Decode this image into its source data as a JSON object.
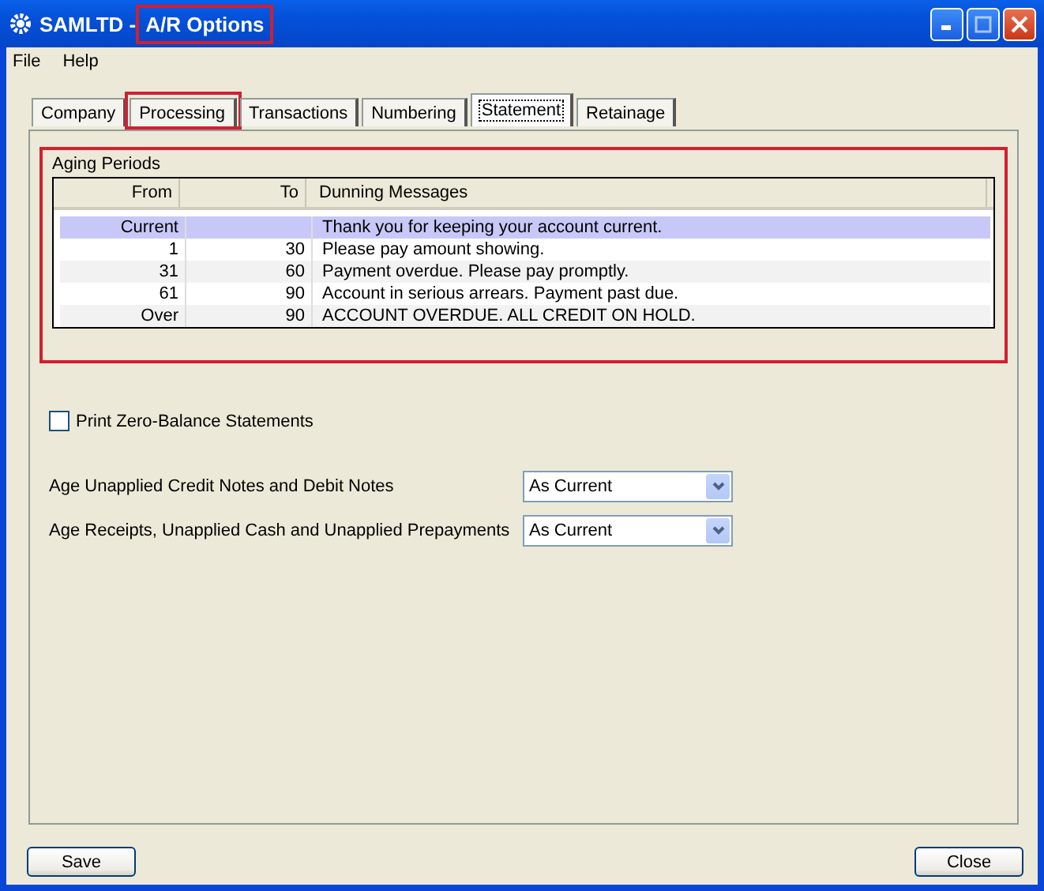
{
  "window": {
    "app": "SAMLTD - ",
    "title": "A/R Options",
    "title_highlighted": true
  },
  "menu": [
    "File",
    "Help"
  ],
  "tabs": [
    {
      "label": "Company",
      "selected": false,
      "highlighted": false
    },
    {
      "label": "Processing",
      "selected": false,
      "highlighted": true
    },
    {
      "label": "Transactions",
      "selected": false,
      "highlighted": false
    },
    {
      "label": "Numbering",
      "selected": false,
      "highlighted": false
    },
    {
      "label": "Statement",
      "selected": true,
      "highlighted": false
    },
    {
      "label": "Retainage",
      "selected": false,
      "highlighted": false
    }
  ],
  "aging_periods": {
    "label": "Aging Periods",
    "highlighted": true,
    "columns": [
      "From",
      "To",
      "Dunning Messages"
    ],
    "rows": [
      {
        "from": "Current",
        "to": "",
        "message": "Thank you for keeping your account current.",
        "selected": true
      },
      {
        "from": "1",
        "to": "30",
        "message": "Please pay amount showing.",
        "selected": false
      },
      {
        "from": "31",
        "to": "60",
        "message": "Payment overdue. Please pay promptly.",
        "selected": false
      },
      {
        "from": "61",
        "to": "90",
        "message": "Account in serious arrears. Payment past due.",
        "selected": false
      },
      {
        "from": "Over",
        "to": "90",
        "message": "ACCOUNT OVERDUE. ALL CREDIT ON HOLD.",
        "selected": false
      }
    ]
  },
  "print_zero_balance": {
    "label": "Print Zero-Balance Statements",
    "checked": false
  },
  "options": [
    {
      "label": "Age Unapplied Credit Notes and Debit Notes",
      "value": "As Current"
    },
    {
      "label": "Age Receipts, Unapplied Cash and Unapplied Prepayments",
      "value": "As Current"
    }
  ],
  "buttons": [
    "Save",
    "Close"
  ]
}
